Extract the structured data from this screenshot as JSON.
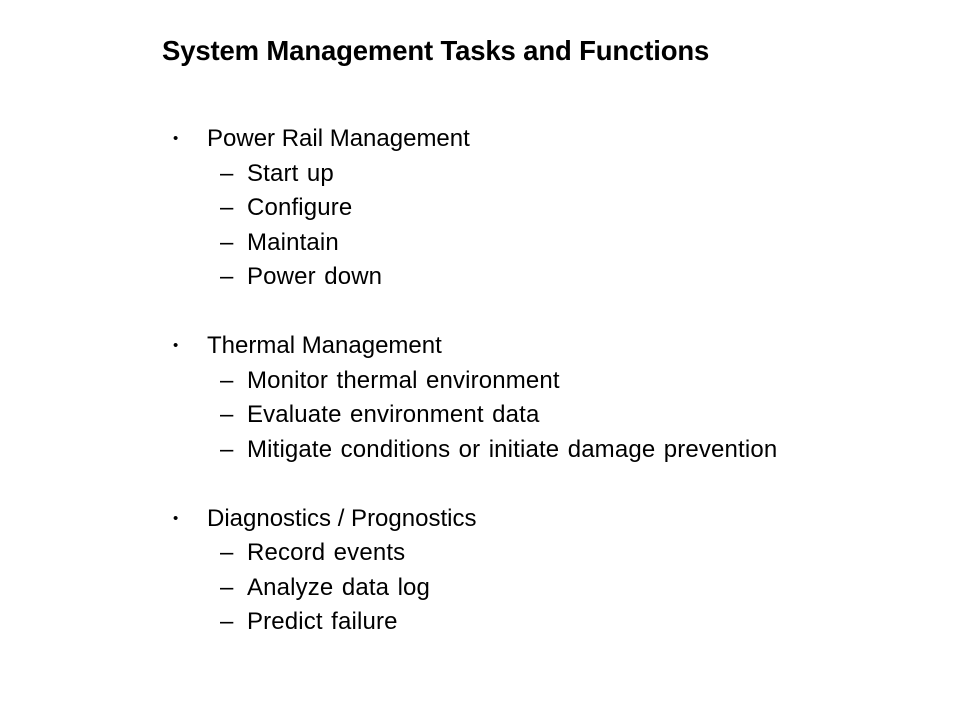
{
  "slide": {
    "title": "System Management Tasks and Functions",
    "background_color": "#ffffff",
    "text_color": "#000000",
    "bullet_marker": "•",
    "dash_marker": "–",
    "groups": [
      {
        "heading": "Power Rail Management",
        "items": [
          "Start up",
          "Configure",
          "Maintain",
          "Power down"
        ]
      },
      {
        "heading": "Thermal Management",
        "items": [
          "Monitor thermal environment",
          "Evaluate environment data",
          "Mitigate conditions or initiate damage prevention"
        ]
      },
      {
        "heading": "Diagnostics / Prognostics",
        "items": [
          "Record events",
          "Analyze data log",
          "Predict failure"
        ]
      }
    ]
  }
}
